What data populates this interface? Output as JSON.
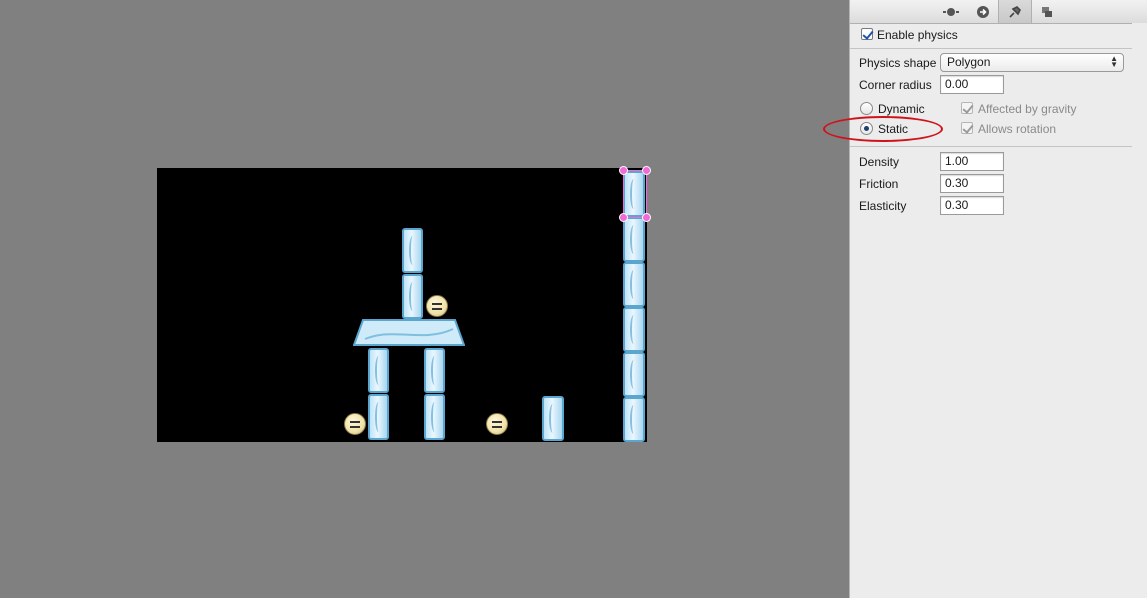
{
  "toolbar": {
    "tabs": [
      {
        "icon": "node-properties-icon"
      },
      {
        "icon": "arrow-circle-icon"
      },
      {
        "icon": "pin-icon",
        "active": true
      },
      {
        "icon": "layers-icon"
      }
    ]
  },
  "physics": {
    "enable_label": "Enable physics",
    "enable_checked": true,
    "shape_label": "Physics shape",
    "shape_value": "Polygon",
    "corner_radius_label": "Corner radius",
    "corner_radius_value": "0.00",
    "body_type": {
      "dynamic_label": "Dynamic",
      "static_label": "Static",
      "selected": "Static"
    },
    "affected_by_gravity_label": "Affected by gravity",
    "allows_rotation_label": "Allows rotation",
    "density_label": "Density",
    "density_value": "1.00",
    "friction_label": "Friction",
    "friction_value": "0.30",
    "elasticity_label": "Elasticity",
    "elasticity_value": "0.30"
  },
  "colors": {
    "workspace_bg": "#808080",
    "scene_bg": "#000000",
    "ice_border": "#5aa6cf",
    "selection_handle": "#f06ad8",
    "annotation_ellipse": "#d0121b",
    "panel_bg": "#ececec"
  }
}
